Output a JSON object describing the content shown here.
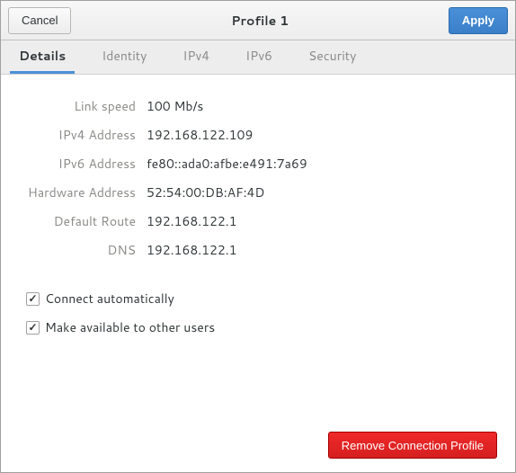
{
  "header": {
    "cancel_label": "Cancel",
    "title": "Profile 1",
    "apply_label": "Apply"
  },
  "tabs": {
    "details": "Details",
    "identity": "Identity",
    "ipv4": "IPv4",
    "ipv6": "IPv6",
    "security": "Security"
  },
  "details": {
    "link_speed_label": "Link speed",
    "link_speed_value": "100 Mb/s",
    "ipv4_label": "IPv4 Address",
    "ipv4_value": "192.168.122.109",
    "ipv6_label": "IPv6 Address",
    "ipv6_value": "fe80::ada0:afbe:e491:7a69",
    "hw_label": "Hardware Address",
    "hw_value": "52:54:00:DB:AF:4D",
    "route_label": "Default Route",
    "route_value": "192.168.122.1",
    "dns_label": "DNS",
    "dns_value": "192.168.122.1"
  },
  "checkboxes": {
    "connect_auto_label": "Connect automatically",
    "connect_auto_checked": true,
    "available_others_label": "Make available to other users",
    "available_others_checked": true
  },
  "footer": {
    "remove_label": "Remove Connection Profile"
  }
}
